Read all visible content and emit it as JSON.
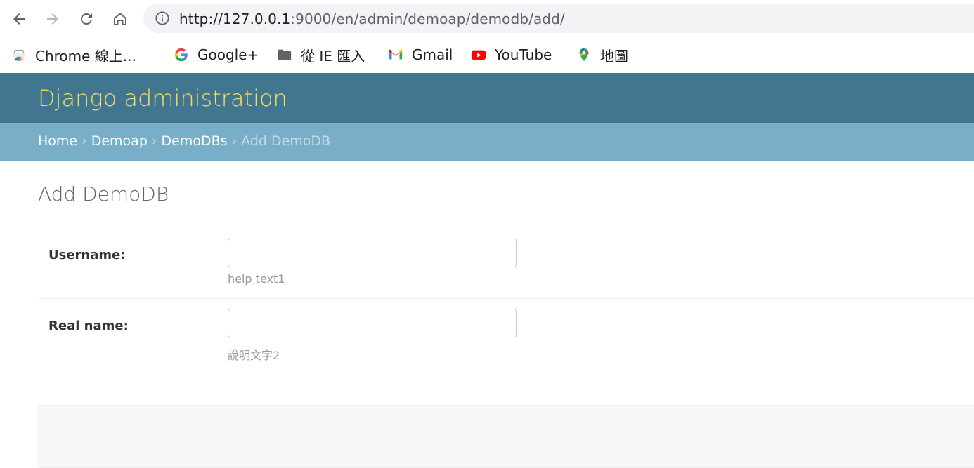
{
  "browser": {
    "url_host": "http://127.0.0.1",
    "url_rest": ":9000/en/admin/demoap/demodb/add/"
  },
  "bookmarks": [
    {
      "label": "Chrome 線上...",
      "icon": "chrome-webstore-icon"
    },
    {
      "label": "Google+",
      "icon": "google-icon"
    },
    {
      "label": "從 IE 匯入",
      "icon": "folder-icon"
    },
    {
      "label": "Gmail",
      "icon": "gmail-icon"
    },
    {
      "label": "YouTube",
      "icon": "youtube-icon"
    },
    {
      "label": "地圖",
      "icon": "maps-icon"
    }
  ],
  "admin": {
    "branding": "Django administration",
    "breadcrumbs": {
      "home": "Home",
      "app": "Demoap",
      "model": "DemoDBs",
      "current": "Add DemoDB",
      "separator": "›"
    },
    "page_title": "Add DemoDB",
    "fields": [
      {
        "label": "Username:",
        "value": "",
        "help": "help text1"
      },
      {
        "label": "Real name:",
        "value": "",
        "help": "說明文字2"
      }
    ]
  },
  "colors": {
    "header_bg": "#417690",
    "branding": "#f5dd5d",
    "breadcrumbs_bg": "#79aec8",
    "omnibox_bg": "#f1f3f4"
  }
}
